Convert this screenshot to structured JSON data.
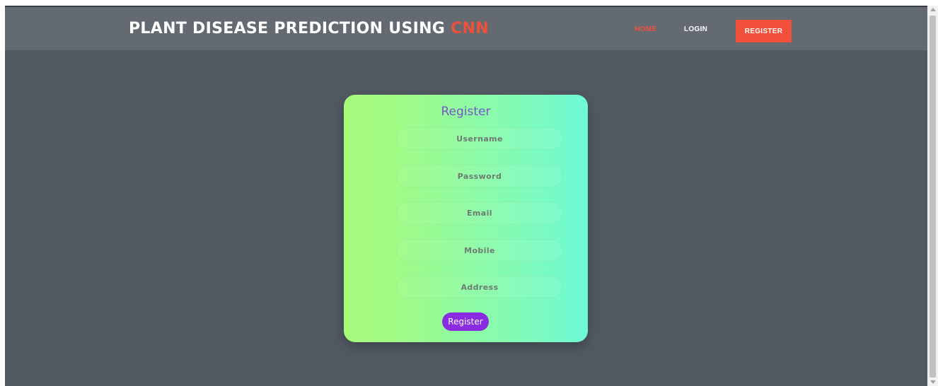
{
  "navbar": {
    "brand_main": "PLANT DISEASE PREDICTION USING ",
    "brand_accent": "CNN",
    "links": {
      "home": "HOME",
      "login": "LOGIN",
      "register": "REGISTER"
    }
  },
  "form": {
    "title": "Register",
    "fields": {
      "username": "Username",
      "password": "Password",
      "email": "Email",
      "mobile": "Mobile",
      "address": "Address"
    },
    "submit_label": "Register"
  },
  "colors": {
    "accent": "#f0503a",
    "page_bg": "#525962",
    "navbar_bg": "#646a72",
    "button": "#8a2be2",
    "title": "#7a55c8"
  }
}
